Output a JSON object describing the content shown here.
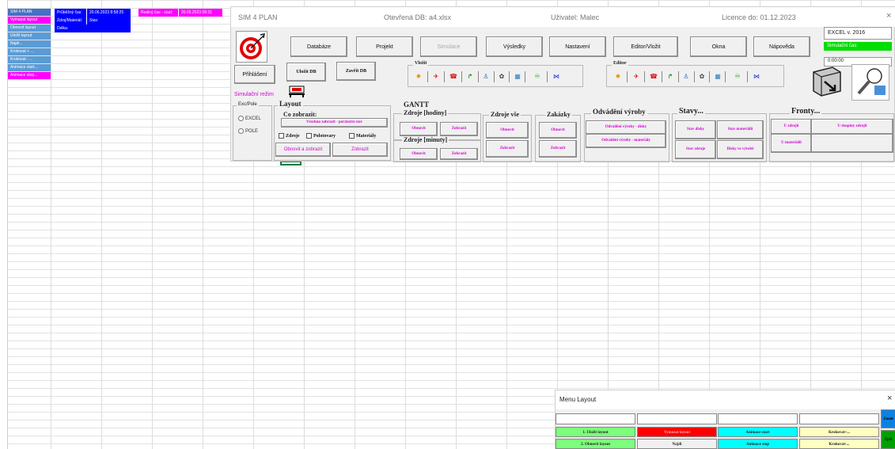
{
  "sheet": {
    "side_buttons": [
      {
        "label": "SIM 4 PLAN",
        "color": "#4472c4"
      },
      {
        "label": "Vymazat layout",
        "color": "#ff00ff"
      },
      {
        "label": "Obnovit layout",
        "color": "#5b9bd5"
      },
      {
        "label": "Uložit layout",
        "color": "#5b9bd5"
      },
      {
        "label": "Najdi...",
        "color": "#5b9bd5"
      },
      {
        "label": "Krokovat + ...",
        "color": "#5b9bd5"
      },
      {
        "label": "Krokovat - ...",
        "color": "#5b9bd5"
      },
      {
        "label": "Animace start...",
        "color": "#5b9bd5"
      },
      {
        "label": "Animace stop...",
        "color": "#ff00ff"
      }
    ],
    "info_row1": [
      "Průběžný čas:",
      "20.06.2023 8:58:25",
      "Reálný čas - start:",
      "20.06.2023 08:31"
    ],
    "info_row2": [
      "Zdroj/Materiál:",
      "Stav:"
    ],
    "info_row3": [
      "Délka:"
    ]
  },
  "main_window": {
    "title": "SIM 4 PLAN",
    "db": "Otevřená DB: a4.xlsx",
    "user": "Uživatel: Malec",
    "licence": "Licence do: 01.12.2023",
    "close": "×",
    "menu": [
      "Databáze",
      "Projekt",
      "Simulace",
      "Výsledky",
      "Nastavení",
      "Editor/Vložit",
      "Okna",
      "Nápověda"
    ],
    "version": "EXCEL v. 2016",
    "sim_time_label": "Simulační čas:",
    "sim_time_value": "0:00:00",
    "login": "Přihlášení",
    "sim_mode": "Simulační režim",
    "save_db": "Uložit DB",
    "close_db": "Zavřít DB",
    "insert_label": "Vložit",
    "editor_label": "Editor",
    "excpole_label": "Exc/Pole",
    "radio_excel": "EXCEL",
    "radio_pole": "POLE",
    "layout_label": "Layout",
    "co_zobrazit": "Co zobrazit:",
    "vsechno": "Všechno zobrazit - počáteční stav",
    "chk_zdroje": "Zdroje",
    "chk_polotovary": "Polotovary",
    "chk_materialy": "Materiály",
    "obnovit_zobrazit": "Obnovit a zobrazit",
    "zobrazit": "Zobrazit",
    "gantt_label": "GANTT",
    "zdroje_hodiny": "Zdroje [hodiny]",
    "zdroje_minuty": "Zdroje [minuty]",
    "zdroje_vse": "Zdroje vše",
    "zakazky": "Zakázky",
    "obnovit": "Obnovit",
    "odvadeni": "Odvádění výroby",
    "odv_disky": "Odvádění výroby - dísky",
    "odv_materialy": "Odvádění výroby - materiály",
    "stavy": "Stavy...",
    "stav_disky": "Stav dísky",
    "stav_materialu": "Stav materiálů",
    "stav_zdroje": "Stav zdroje",
    "disky_ve_vyrobe": "Dísky ve výrobě",
    "fronty": "Fronty...",
    "u_zdroju": "U zdrojů",
    "u_skupiny": "U skupiny zdrojů",
    "u_materialu": "U materiálů"
  },
  "menu_layout": {
    "title": "Menu Layout",
    "close": "×",
    "row1": [
      "1. Uložit layout",
      "Vymazat layout",
      "Animace start",
      "Krokovat+..."
    ],
    "row2": [
      "2. Obnovit layout",
      "Najdi",
      "Animace stop",
      "Krokovat-..."
    ],
    "side1": "Zoom",
    "side2": "Zpět"
  },
  "colors": {
    "magenta": "#ff00ff",
    "blue": "#0000ff",
    "green": "#00cc00",
    "red": "#ff0000",
    "cyan": "#00ffff",
    "lightgreen": "#7cff7c",
    "lightyellow": "#ffffc0"
  }
}
